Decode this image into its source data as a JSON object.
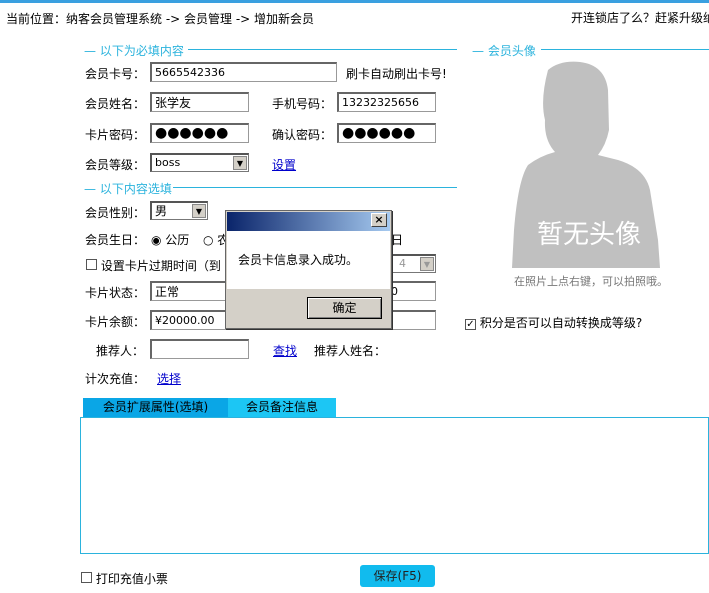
{
  "breadcrumb": "当前位置：纳客会员管理系统 -> 会员管理 -> 增加新会员",
  "promo": "开连锁店了么？赶紧升级纳",
  "required_legend": "— 以下为必填内容",
  "optional_legend": "— 以下内容选填",
  "avatar_legend": "— 会员头像",
  "fields": {
    "card_no_label": "会员卡号：",
    "card_no": "5665542336",
    "card_hint": "刷卡自动刷出卡号!",
    "name_label": "会员姓名：",
    "name": "张学友",
    "phone_label": "手机号码：",
    "phone": "13232325656",
    "pwd_label": "卡片密码：",
    "pwd": "●●●●●●",
    "pwd2_label": "确认密码：",
    "pwd2": "●●●●●●",
    "level_label": "会员等级：",
    "level": "boss",
    "level_link": "设置",
    "gender_label": "会员性别：",
    "gender": "男",
    "birthday_label": "会员生日：",
    "birthday_opt1": "公历",
    "birthday_opt2": "农",
    "birthday_day_suffix": "日",
    "expire_label": "设置卡片过期时间（到",
    "expire_value": "4",
    "status_label": "卡片状态：",
    "status": "正常",
    "status_right": "0",
    "balance_label": "卡片余额：",
    "balance": "¥20000.00",
    "referrer_label": "推荐人：",
    "referrer": "",
    "referrer_link": "查找",
    "referrer_name_label": "推荐人姓名：",
    "count_label": "计次充值：",
    "count_link": "选择"
  },
  "avatar": {
    "placeholder": "暂无头像",
    "hint": "在照片上点右键，可以拍照哦。"
  },
  "auto_level": {
    "label": "积分是否可以自动转换成等级?",
    "checked": true
  },
  "tabs": [
    {
      "label": "会员扩展属性(选填)",
      "active": true
    },
    {
      "label": "会员备注信息",
      "active": false
    }
  ],
  "footer": {
    "print_label": "打印充值小票",
    "print_checked": false,
    "save_label": "保存(F5)"
  },
  "dialog": {
    "message": "会员卡信息录入成功。",
    "ok": "确定",
    "close": "×"
  }
}
